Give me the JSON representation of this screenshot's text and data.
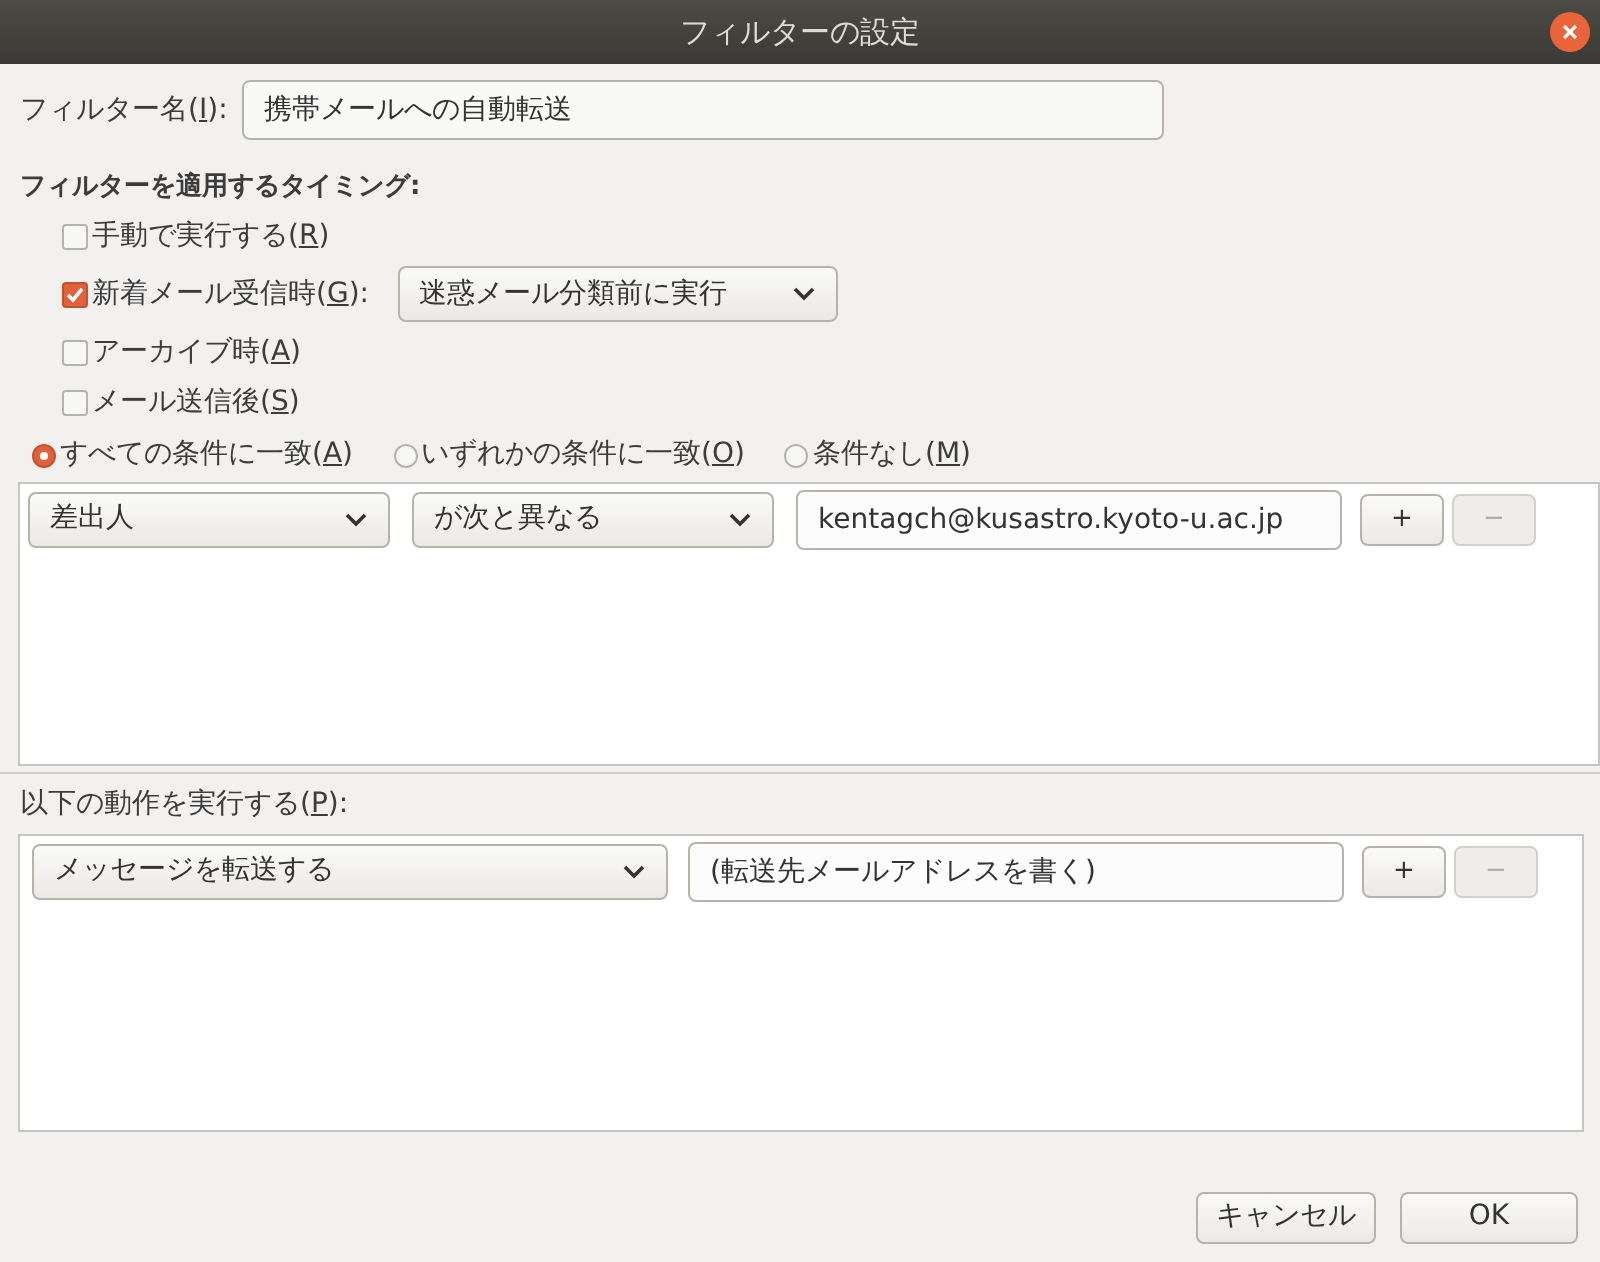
{
  "window": {
    "title": "フィルターの設定"
  },
  "filter_name": {
    "label_before": "フィルター名(",
    "key": "I",
    "label_after": "):",
    "value": "携帯メールへの自動転送"
  },
  "timing": {
    "heading": "フィルターを適用するタイミング:",
    "options": [
      {
        "kind": "checkbox",
        "label_before": "手動で実行する(",
        "key": "R",
        "label_after": ")",
        "checked": false
      },
      {
        "kind": "checkbox_select",
        "label_before": "新着メール受信時(",
        "key": "G",
        "label_after": "):",
        "checked": true,
        "select_value": "迷惑メール分類前に実行"
      },
      {
        "kind": "checkbox",
        "label_before": "アーカイブ時(",
        "key": "A",
        "label_after": ")",
        "checked": false
      },
      {
        "kind": "checkbox",
        "label_before": "メール送信後(",
        "key": "S",
        "label_after": ")",
        "checked": false
      }
    ]
  },
  "match": [
    {
      "label_before": "すべての条件に一致(",
      "key": "A",
      "label_after": ")",
      "selected": true
    },
    {
      "label_before": "いずれかの条件に一致(",
      "key": "O",
      "label_after": ")",
      "selected": false
    },
    {
      "label_before": "条件なし(",
      "key": "M",
      "label_after": ")",
      "selected": false
    }
  ],
  "conditions": [
    {
      "field": "差出人",
      "operator": "が次と異なる",
      "value": "kentagch@kusastro.kyoto-u.ac.jp",
      "add": "+",
      "remove": "−",
      "remove_disabled": true
    }
  ],
  "actions_label": {
    "label_before": "以下の動作を実行する(",
    "key": "P",
    "label_after": "):"
  },
  "actions": [
    {
      "action": "メッセージを転送する",
      "value": "(転送先メールアドレスを書く)",
      "add": "+",
      "remove": "−",
      "remove_disabled": true
    }
  ],
  "buttons": [
    {
      "label": "キャンセル"
    },
    {
      "label": "OK"
    }
  ]
}
